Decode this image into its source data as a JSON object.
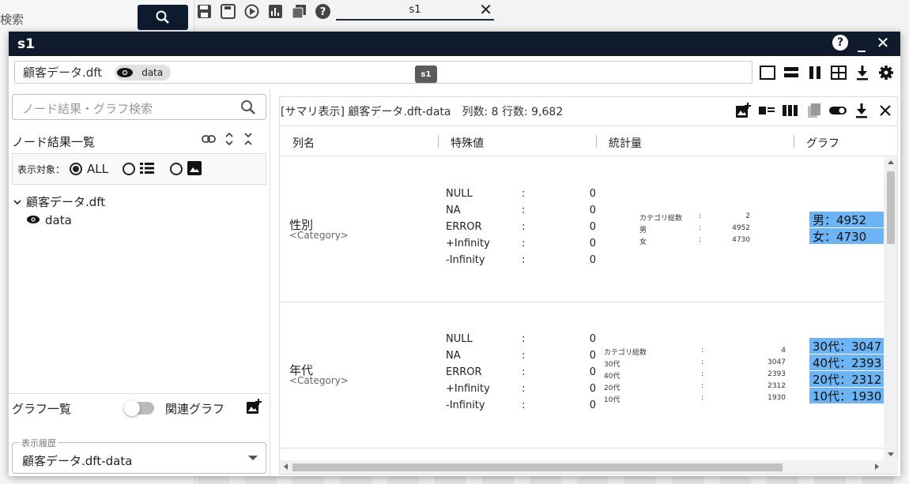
{
  "background": {
    "search_text": "検索",
    "tab_label": "s1"
  },
  "window": {
    "title": "s1",
    "help": "?",
    "minimize": "_",
    "close": "✕"
  },
  "file_bar": {
    "file_name": "顧客データ.dft",
    "chip_label": "data",
    "badge": "s1"
  },
  "left_panel": {
    "search_placeholder": "ノード結果・グラフ検索",
    "node_list_title": "ノード結果一覧",
    "filter_label": "表示対象：",
    "filter_all": "ALL",
    "tree": {
      "parent": "顧客データ.dft",
      "child": "data"
    },
    "graph_list_title": "グラフ一覧",
    "related_graph_label": "関連グラフ",
    "history_label": "表示履歴",
    "history_value": "顧客データ.dft-data"
  },
  "right_panel": {
    "title": "[サマリ表示] 顧客データ.dft-data",
    "meta": "列数: 8 行数: 9,682",
    "columns": [
      "列名",
      "特殊値",
      "統計量",
      "グラフ"
    ],
    "rows": [
      {
        "name": "性別",
        "type": "<Category>",
        "special": [
          {
            "label": "NULL",
            "value": "0"
          },
          {
            "label": "NA",
            "value": "0"
          },
          {
            "label": "ERROR",
            "value": "0"
          },
          {
            "label": "+Infinity",
            "value": "0"
          },
          {
            "label": "-Infinity",
            "value": "0"
          }
        ],
        "stats": [
          {
            "label": "カテゴリ総数",
            "value": "2"
          },
          {
            "label": "男",
            "value": "4952"
          },
          {
            "label": "女",
            "value": "4730"
          }
        ],
        "bars": [
          "男：4952",
          "女：4730"
        ]
      },
      {
        "name": "年代",
        "type": "<Category>",
        "special": [
          {
            "label": "NULL",
            "value": "0"
          },
          {
            "label": "NA",
            "value": "0"
          },
          {
            "label": "ERROR",
            "value": "0"
          },
          {
            "label": "+Infinity",
            "value": "0"
          },
          {
            "label": "-Infinity",
            "value": "0"
          }
        ],
        "stats": [
          {
            "label": "カテゴリ総数",
            "value": "4"
          },
          {
            "label": "30代",
            "value": "3047"
          },
          {
            "label": "40代",
            "value": "2393"
          },
          {
            "label": "20代",
            "value": "2312"
          },
          {
            "label": "10代",
            "value": "1930"
          }
        ],
        "bars": [
          "30代：3047",
          "40代：2393",
          "20代：2312",
          "10代：1930"
        ]
      }
    ]
  },
  "colors": {
    "title_bar": "#0f1b2d",
    "bar_fill": "#6cb4f4"
  }
}
